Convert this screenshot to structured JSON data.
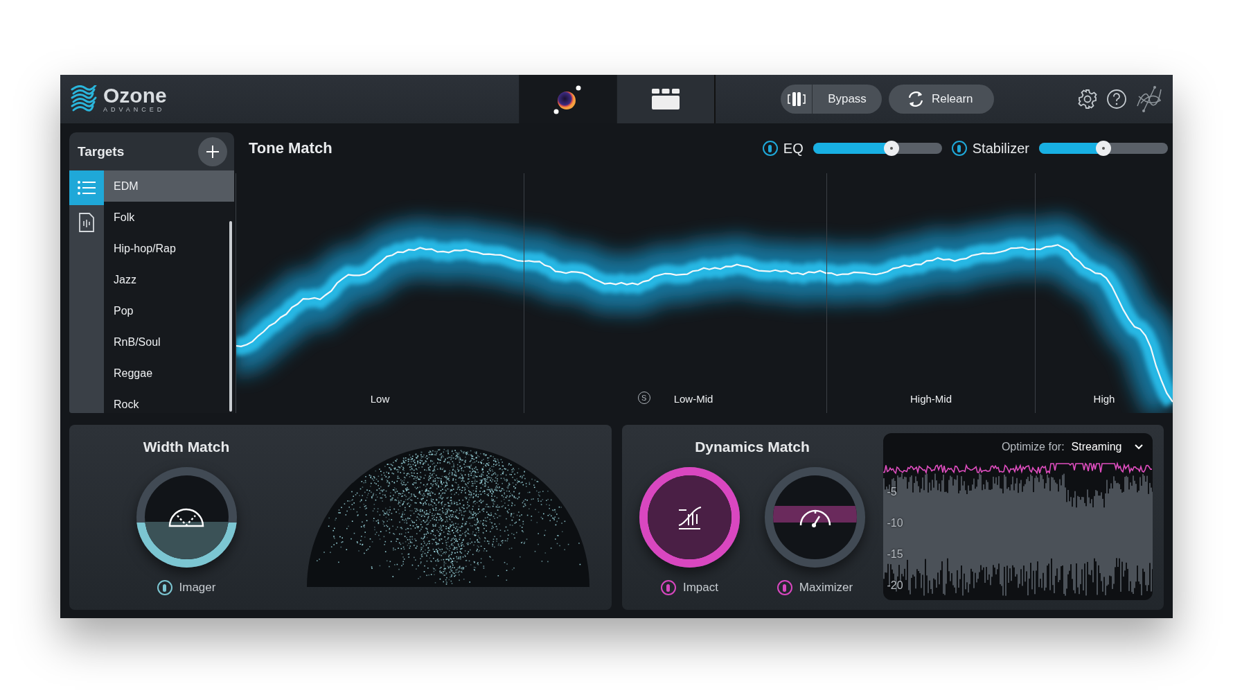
{
  "app": {
    "logo_name": "Ozone",
    "logo_edition": "ADVANCED"
  },
  "view_tabs": [
    {
      "kind": "orb",
      "selected": true
    },
    {
      "kind": "modules",
      "selected": false
    }
  ],
  "toolbar": {
    "bypass": "Bypass",
    "relearn": "Relearn"
  },
  "targets": {
    "title": "Targets",
    "side_tabs": [
      {
        "kind": "list",
        "selected": true
      },
      {
        "kind": "file",
        "selected": false
      }
    ],
    "items": [
      {
        "label": "EDM",
        "selected": true
      },
      {
        "label": "Folk",
        "selected": false
      },
      {
        "label": "Hip-hop/Rap",
        "selected": false
      },
      {
        "label": "Jazz",
        "selected": false
      },
      {
        "label": "Pop",
        "selected": false
      },
      {
        "label": "RnB/Soul",
        "selected": false
      },
      {
        "label": "Reggae",
        "selected": false
      },
      {
        "label": "Rock",
        "selected": false
      }
    ]
  },
  "tone_match": {
    "title": "Tone Match",
    "controls": [
      {
        "label": "EQ",
        "on": true,
        "level": 0.61
      },
      {
        "label": "Stabilizer",
        "on": true,
        "level": 0.5
      }
    ],
    "solo": "S",
    "bands": [
      "Low",
      "Low-Mid",
      "High-Mid",
      "High"
    ]
  },
  "width_match": {
    "title": "Width Match",
    "module": {
      "label": "Imager",
      "on": true,
      "level": 0.45
    }
  },
  "dynamics_match": {
    "title": "Dynamics Match",
    "modules": [
      {
        "kind": "impact",
        "label": "Impact",
        "on": true,
        "level": 1
      },
      {
        "kind": "maximizer",
        "label": "Maximizer",
        "on": true
      }
    ],
    "optimize_label": "Optimize for:",
    "optimize_value": "Streaming",
    "scale": [
      "-5",
      "-10",
      "-15",
      "-20"
    ]
  }
}
